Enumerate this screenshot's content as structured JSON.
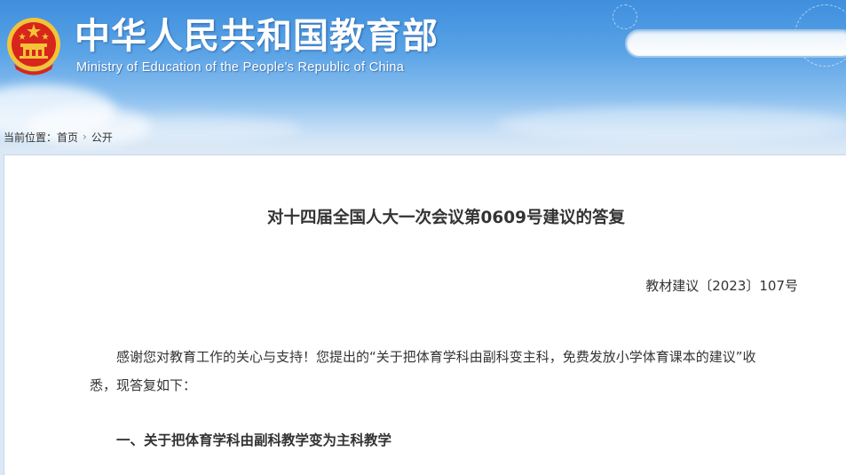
{
  "header": {
    "title": "中华人民共和国教育部",
    "subtitle": "Ministry of Education of the People's Republic of China",
    "search_placeholder": ""
  },
  "breadcrumb": {
    "label": "当前位置：",
    "items": [
      {
        "text": "首页"
      },
      {
        "text": "公开"
      }
    ]
  },
  "document": {
    "title": "对十四届全国人大一次会议第0609号建议的答复",
    "number": "教材建议〔2023〕107号",
    "paragraph": "感谢您对教育工作的关心与支持！您提出的“关于把体育学科由副科变主科，免费发放小学体育课本的建议”收悉，现答复如下：",
    "section_heading": "一、关于把体育学科由副科教学变为主科教学"
  },
  "colors": {
    "header_top": "#3f8fde",
    "emblem_red": "#d8261c",
    "emblem_gold": "#f3c338",
    "text": "#333333"
  }
}
